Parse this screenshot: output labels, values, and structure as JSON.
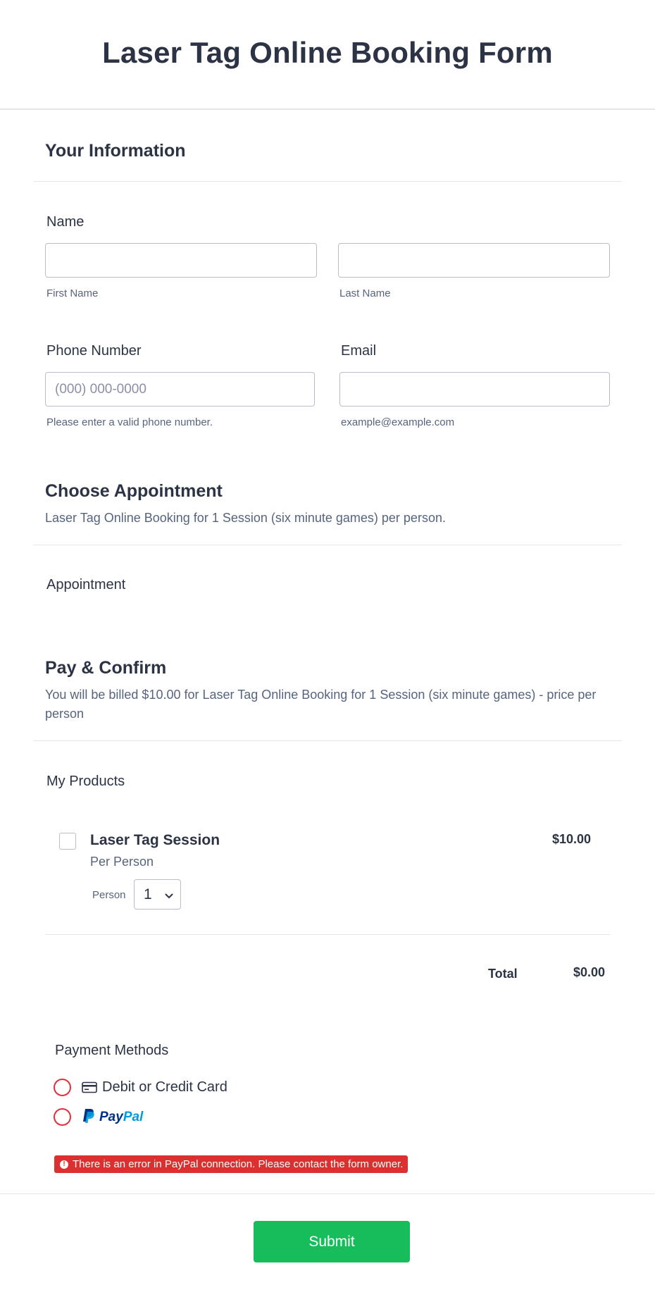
{
  "form": {
    "title": "Laser Tag Online Booking Form"
  },
  "your_info": {
    "heading": "Your Information",
    "name_label": "Name",
    "first_name_sublabel": "First Name",
    "last_name_sublabel": "Last Name",
    "first_name_value": "",
    "last_name_value": "",
    "phone_label": "Phone Number",
    "phone_placeholder": "(000) 000-0000",
    "phone_sublabel": "Please enter a valid phone number.",
    "email_label": "Email",
    "email_value": "",
    "email_sublabel": "example@example.com"
  },
  "appointment": {
    "heading": "Choose Appointment",
    "description": "Laser Tag Online Booking for 1 Session (six minute games) per person.",
    "label": "Appointment"
  },
  "payment": {
    "heading": "Pay & Confirm",
    "description": "You will be billed $10.00 for Laser Tag Online Booking for 1 Session (six minute games) - price per person",
    "products_label": "My Products",
    "product": {
      "name": "Laser Tag Session",
      "subtitle": "Per Person",
      "price": "$10.00",
      "quantity_label": "Person",
      "quantity_value": "1",
      "checked": false
    },
    "total_label": "Total",
    "total_value": "$0.00",
    "methods_label": "Payment Methods",
    "methods": [
      {
        "label": "Debit or Credit Card",
        "icon": "credit-card-icon",
        "selected": false
      },
      {
        "label": "PayPal",
        "icon": "paypal-logo",
        "selected": false
      }
    ],
    "paypal_brand": {
      "part1": "Pay",
      "part2": "Pal",
      "dark": "#003087",
      "light": "#009cde"
    },
    "error_message": "There is an error in PayPal connection. Please contact the form owner.",
    "error_icon": "!"
  },
  "submit": {
    "label": "Submit"
  },
  "colors": {
    "text": "#2c3345",
    "muted": "#57647e",
    "border": "#b8bdc9",
    "divider": "#e3e5ea",
    "submit": "#18bd5b",
    "error": "#dc2f2f"
  }
}
